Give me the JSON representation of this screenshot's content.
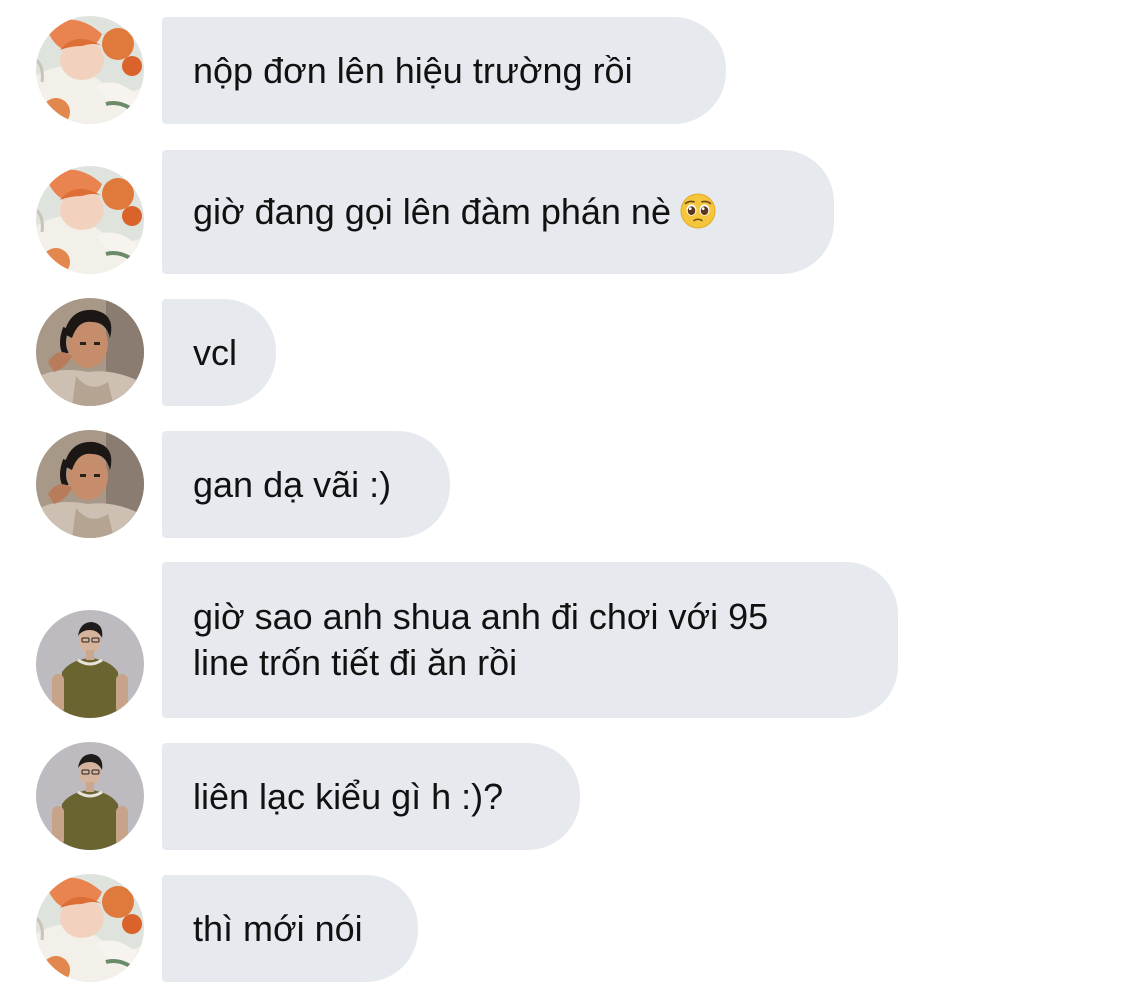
{
  "messages": [
    {
      "sender": "a",
      "text": "nộp đơn lên hiệu trường rồi"
    },
    {
      "sender": "a",
      "text": "giờ đang gọi lên đàm phán nè",
      "emoji": "pleading-face-icon"
    },
    {
      "sender": "b",
      "text": "vcl"
    },
    {
      "sender": "b",
      "text": "gan dạ vãi :)"
    },
    {
      "sender": "c",
      "text_line1": "giờ sao anh shua anh đi chơi với 95",
      "text_line2": "line trốn tiết đi ăn rồi"
    },
    {
      "sender": "c",
      "text": "liên lạc kiểu gì h :)?"
    },
    {
      "sender": "a",
      "text": "thì mới nói"
    }
  ],
  "colors": {
    "bubble": "#e6eaef",
    "text": "#111111",
    "background": "#ffffff"
  }
}
